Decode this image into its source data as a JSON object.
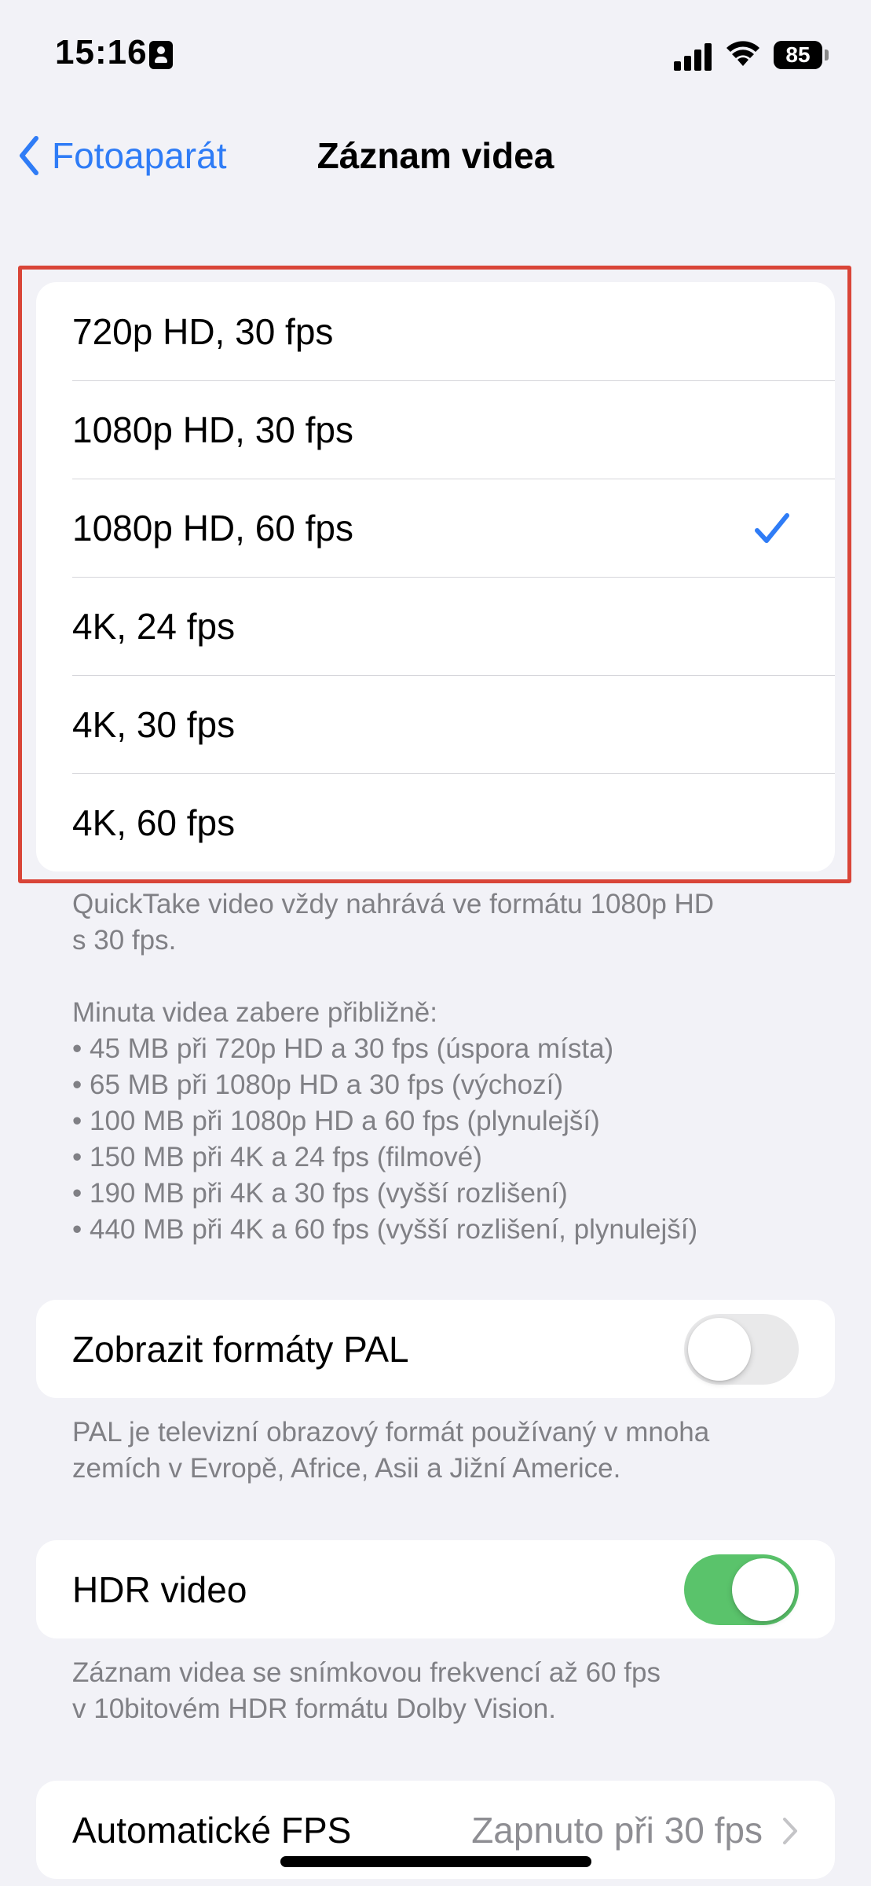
{
  "status_bar": {
    "time": "15:16",
    "battery": "85"
  },
  "nav": {
    "back_label": "Fotoaparát",
    "title": "Záznam videa"
  },
  "formats": [
    {
      "label": "720p HD, 30 fps",
      "selected": false
    },
    {
      "label": "1080p HD, 30 fps",
      "selected": false
    },
    {
      "label": "1080p HD, 60 fps",
      "selected": true
    },
    {
      "label": "4K, 24 fps",
      "selected": false
    },
    {
      "label": "4K, 30 fps",
      "selected": false
    },
    {
      "label": "4K, 60 fps",
      "selected": false
    }
  ],
  "formats_footer": {
    "quicktake_line1": "QuickTake video vždy nahrává ve formátu 1080p HD",
    "quicktake_line2": "s 30 fps.",
    "size_heading": "Minuta videa zabere přibližně:",
    "size_items": [
      "• 45 MB při 720p HD a 30 fps (úspora místa)",
      "• 65 MB při 1080p HD a 30 fps (výchozí)",
      "• 100 MB při 1080p HD a 60 fps (plynulejší)",
      "• 150 MB při 4K a 24 fps (filmové)",
      "• 190 MB při 4K a 30 fps (vyšší rozlišení)",
      "• 440 MB při 4K a 60 fps (vyšší rozlišení, plynulejší)"
    ]
  },
  "pal": {
    "label": "Zobrazit formáty PAL",
    "enabled": false,
    "footer_line1": "PAL je televizní obrazový formát používaný v mnoha",
    "footer_line2": "zemích v Evropě, Africe, Asii a Jižní Americe."
  },
  "hdr": {
    "label": "HDR video",
    "enabled": true,
    "footer_line1": "Záznam videa se snímkovou frekvencí až 60 fps",
    "footer_line2": "v 10bitovém HDR formátu Dolby Vision."
  },
  "auto_fps": {
    "label": "Automatické FPS",
    "value": "Zapnuto při 30 fps"
  },
  "colors": {
    "accent": "#2f7cf6",
    "toggle_on": "#5ac36b",
    "highlight": "#d94538",
    "background": "#f2f2f7"
  }
}
